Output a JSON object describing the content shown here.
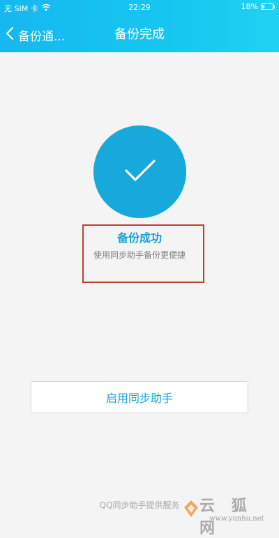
{
  "status_bar": {
    "carrier": "无 SIM 卡",
    "time": "22:29",
    "battery_percent": "18%",
    "battery_level": 0.18,
    "icons": [
      "wifi-icon",
      "battery-icon",
      "charging-icon"
    ]
  },
  "header": {
    "back_label": "备份通...",
    "title": "备份完成",
    "colors": {
      "start": "#16b8ef",
      "end": "#20d2f2"
    }
  },
  "result": {
    "icon": "checkmark-icon",
    "title": "备份成功",
    "subtitle": "使用同步助手备份更便捷",
    "accent_color": "#17a8dc",
    "highlight_color": "#c23c34"
  },
  "cta": {
    "label": "启用同步助手"
  },
  "footer": {
    "text": "QQ同步助手提供服务"
  },
  "watermark": {
    "text": "云 狐 网",
    "url": "www.yunhu.net"
  }
}
